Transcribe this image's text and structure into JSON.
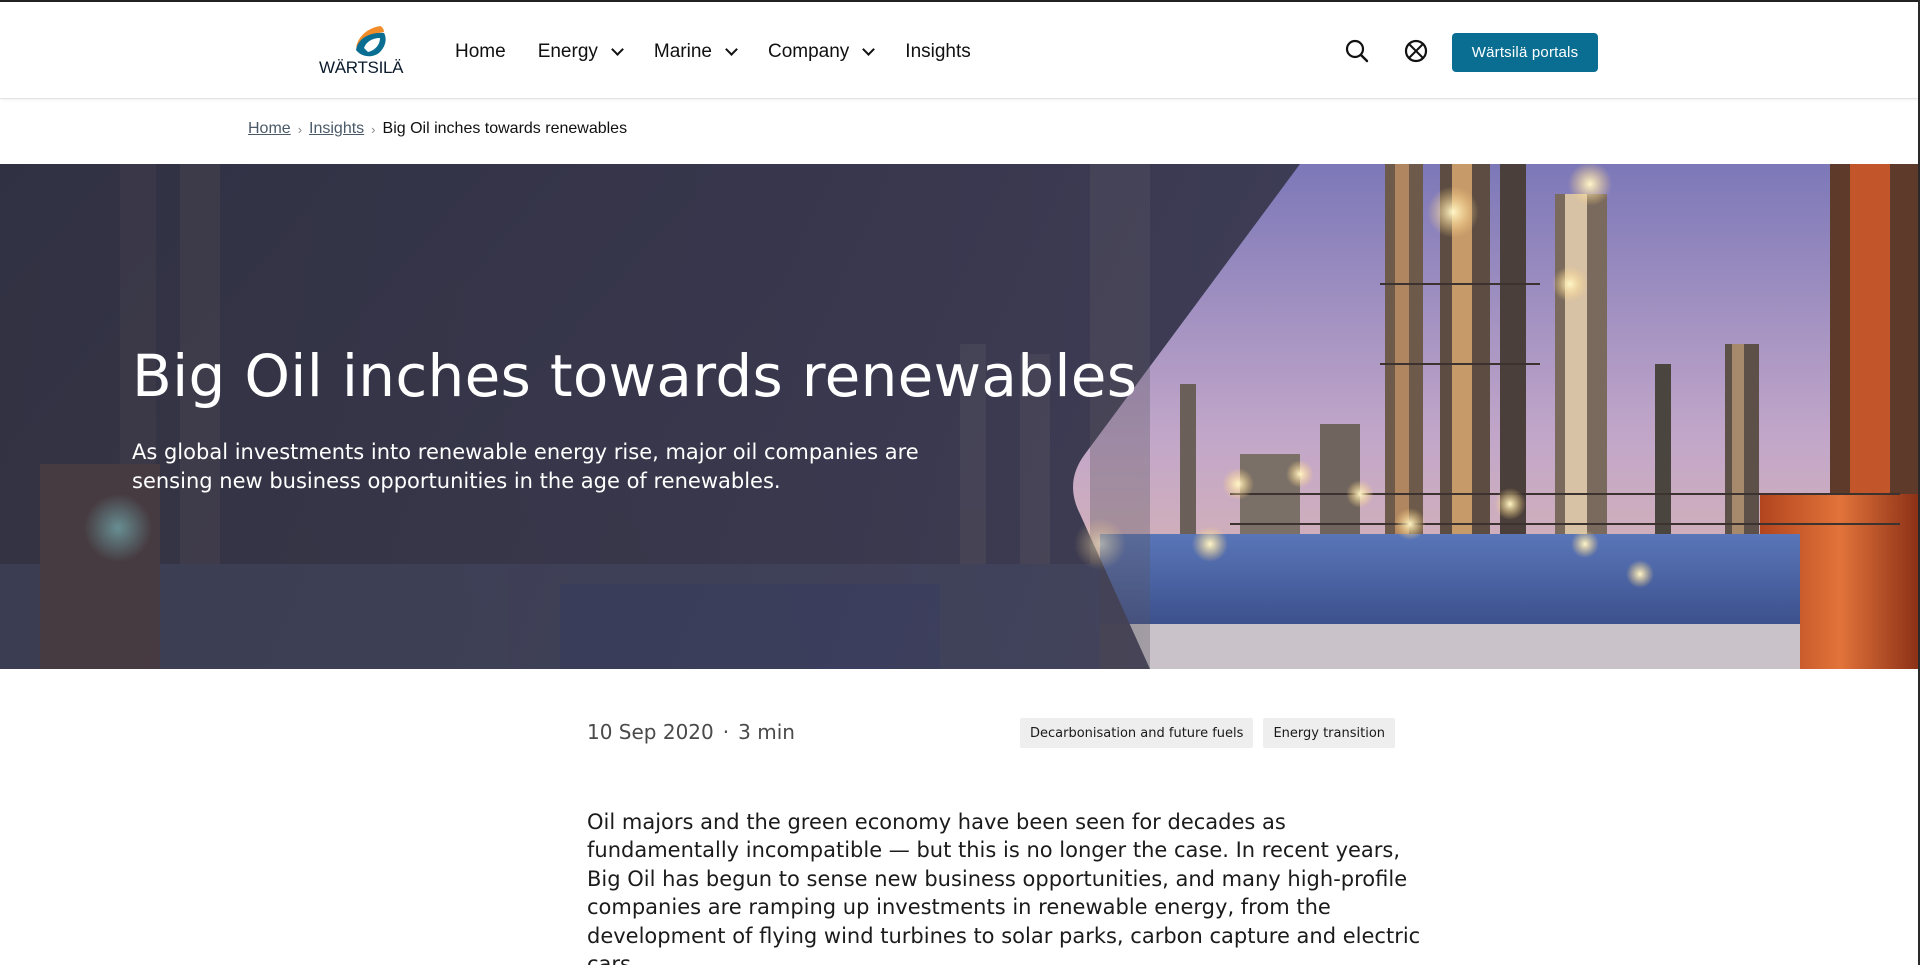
{
  "brand": {
    "wordmark": "WÄRTSILÄ",
    "accent": "#0a6e93",
    "logo_orange": "#f28c28"
  },
  "nav": {
    "items": [
      {
        "label": "Home",
        "has_dropdown": false
      },
      {
        "label": "Energy",
        "has_dropdown": true
      },
      {
        "label": "Marine",
        "has_dropdown": true
      },
      {
        "label": "Company",
        "has_dropdown": true
      },
      {
        "label": "Insights",
        "has_dropdown": false
      }
    ],
    "icons": [
      "search-icon",
      "globe-icon"
    ],
    "portals_label": "Wärtsilä portals"
  },
  "breadcrumb": {
    "items": [
      {
        "label": "Home",
        "link": true
      },
      {
        "label": "Insights",
        "link": true
      }
    ],
    "current": "Big Oil inches towards renewables"
  },
  "hero": {
    "title": "Big Oil inches towards renewables",
    "subtitle": "As global investments into renewable energy rise, major oil companies are sensing new business opportunities in the age of renewables."
  },
  "article": {
    "date": "10 Sep 2020",
    "separator": "·",
    "read_time": "3 min",
    "tags": [
      "Decarbonisation and future fuels",
      "Energy transition"
    ],
    "intro": "Oil majors and the green economy have been seen for decades as fundamentally incompatible — but this is no longer the case. In recent years, Big Oil has begun to sense new business opportunities, and many high-profile companies are ramping up investments in renewable energy, from the development of flying wind turbines to solar parks, carbon capture and electric cars."
  }
}
